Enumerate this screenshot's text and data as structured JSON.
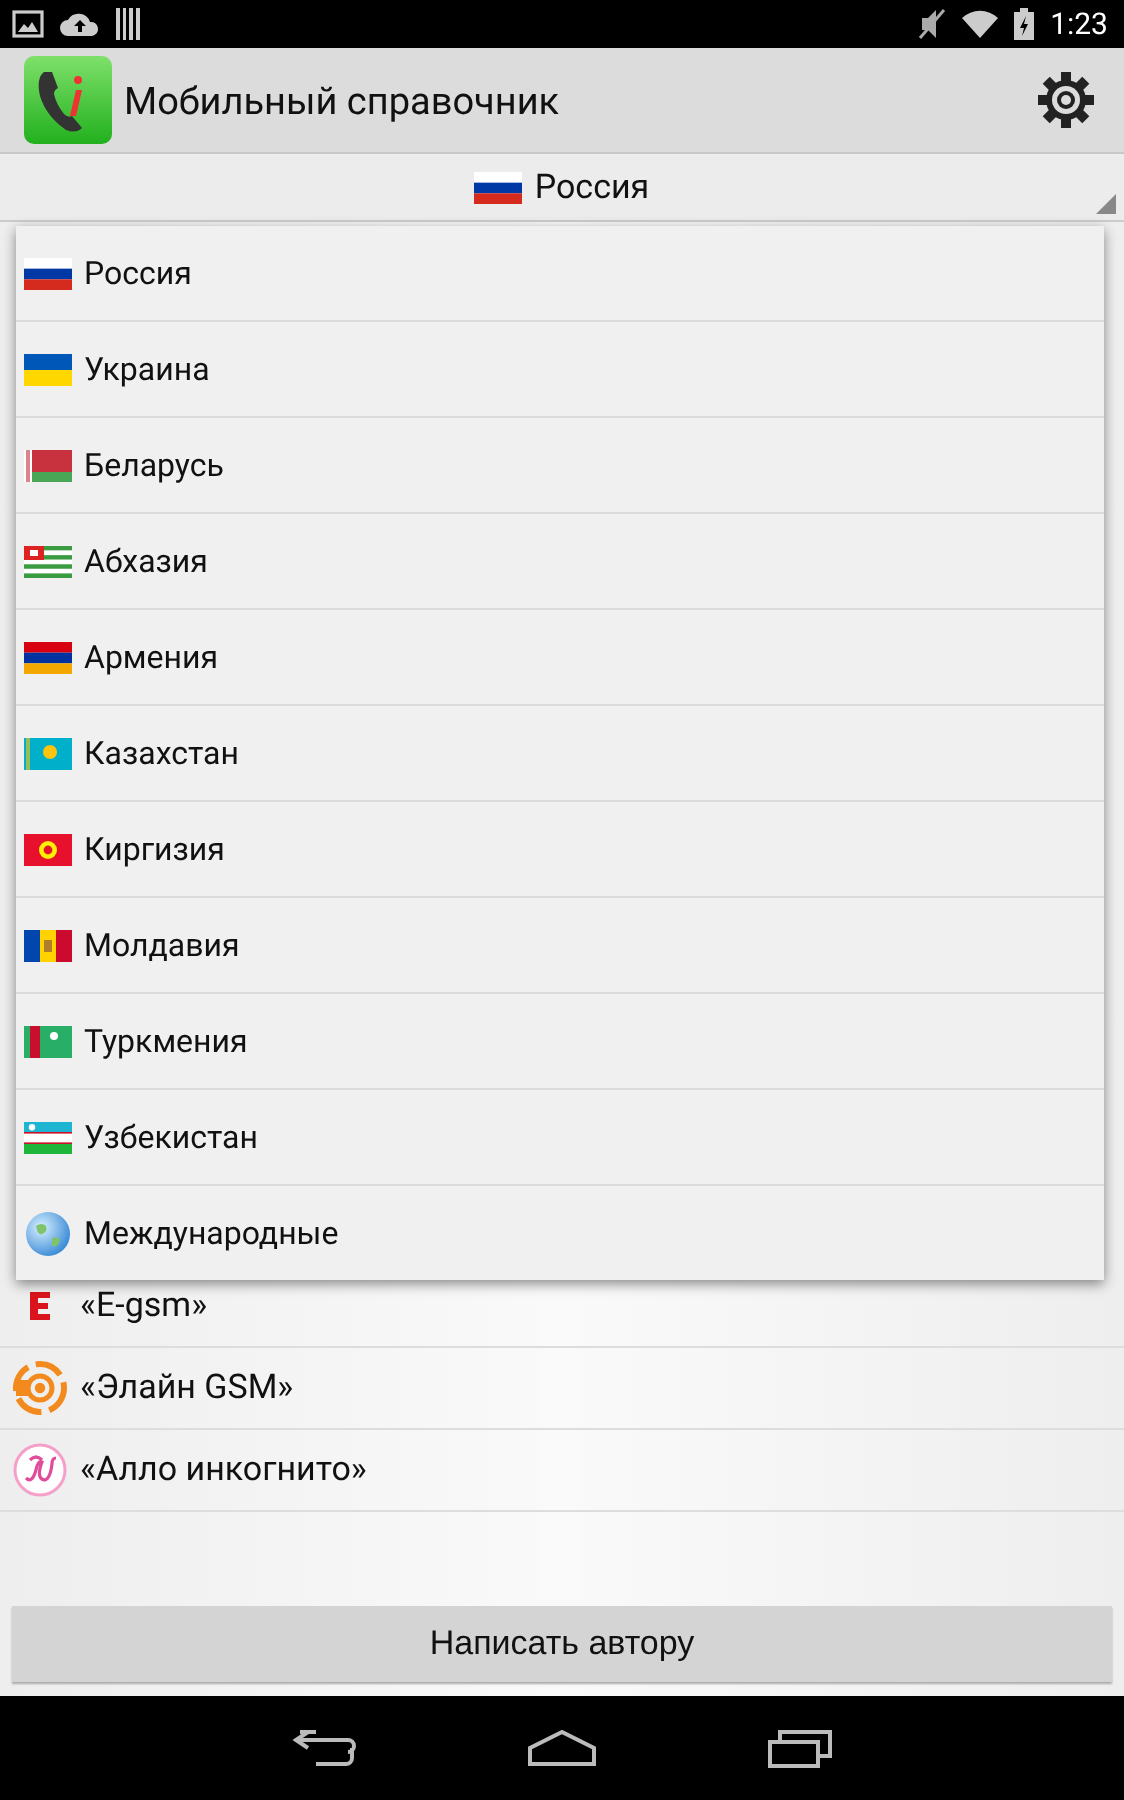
{
  "status_bar": {
    "time": "1:23"
  },
  "app_bar": {
    "title": "Мобильный справочник"
  },
  "spinner": {
    "value": "Россия",
    "kind": "ru"
  },
  "operators": [
    {
      "name": "«E-gsm»",
      "kind": "e"
    },
    {
      "name": "«Элайн GSM»",
      "kind": "elain"
    },
    {
      "name": "«Алло инкогнито»",
      "kind": "allo"
    }
  ],
  "country_menu": [
    {
      "label": "Россия",
      "kind": "ru"
    },
    {
      "label": "Украина",
      "kind": "ua"
    },
    {
      "label": "Беларусь",
      "kind": "by"
    },
    {
      "label": "Абхазия",
      "kind": "abh"
    },
    {
      "label": "Армения",
      "kind": "am"
    },
    {
      "label": "Казахстан",
      "kind": "kz"
    },
    {
      "label": "Киргизия",
      "kind": "kg"
    },
    {
      "label": "Молдавия",
      "kind": "md"
    },
    {
      "label": "Туркмения",
      "kind": "tm"
    },
    {
      "label": "Узбекистан",
      "kind": "uz"
    },
    {
      "label": "Международные",
      "kind": "globe"
    }
  ],
  "footer_button": {
    "label": "Написать автору"
  }
}
